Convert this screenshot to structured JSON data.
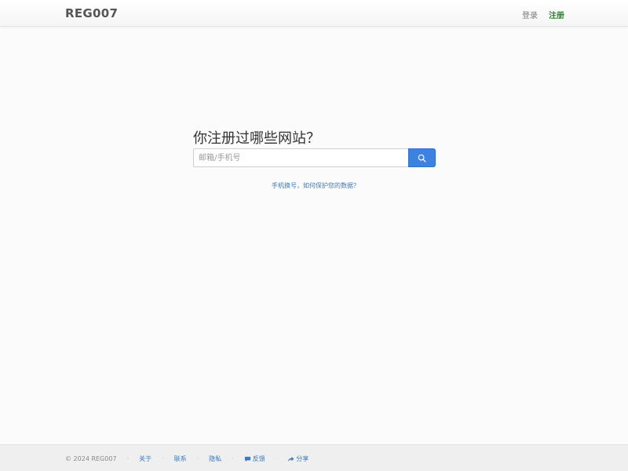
{
  "header": {
    "brand": "REG007",
    "login": "登录",
    "register": "注册"
  },
  "main": {
    "title": "你注册过哪些网站？",
    "search": {
      "placeholder": "邮箱/手机号",
      "value": "",
      "button_icon": "search-icon"
    },
    "privacy_link": "手机换号，如何保护您的数据？"
  },
  "footer": {
    "copyright": "© 2024 REG007",
    "links": {
      "about": "关于",
      "contact": "联系",
      "privacy": "隐私",
      "feedback": "反馈",
      "share": "分享"
    },
    "icons": {
      "feedback": "comment-icon",
      "share": "share-icon"
    }
  },
  "colors": {
    "accent": "#3d82e0",
    "register": "#2e7d32",
    "link": "#3a7bbf"
  }
}
